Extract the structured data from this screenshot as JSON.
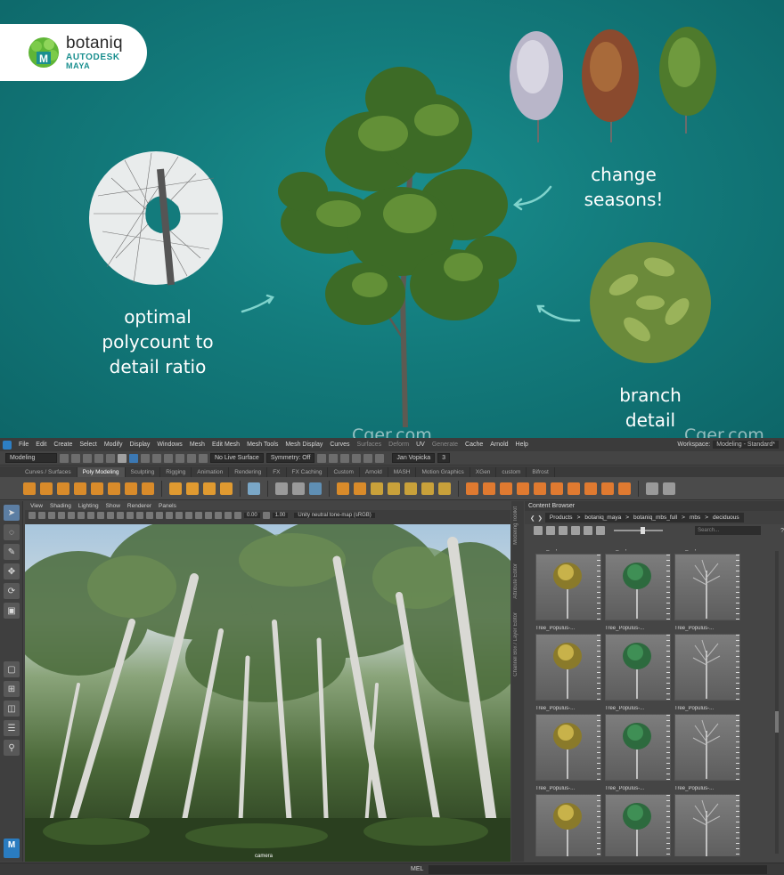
{
  "banner": {
    "logo": {
      "brand": "botaniq",
      "vendor": "AUTODESK",
      "product": "MAYA"
    },
    "captions": {
      "polycount": "optimal polycount to detail ratio",
      "seasons": "change seasons!",
      "branch": "branch detail"
    },
    "watermark_left": "Cger.com",
    "watermark_right": "Cger.com",
    "colors": {
      "background": "#137b7c",
      "accent": "#1a8f8f",
      "arrow": "#7fd3cc"
    }
  },
  "maya": {
    "menubar": {
      "items": [
        "File",
        "Edit",
        "Create",
        "Select",
        "Modify",
        "Display",
        "Windows",
        "Mesh",
        "Edit Mesh",
        "Mesh Tools",
        "Mesh Display",
        "Curves",
        "Surfaces",
        "Deform",
        "UV",
        "Generate",
        "Cache",
        "Arnold",
        "Help"
      ],
      "workspace_label": "Workspace:",
      "workspace_value": "Modeling - Standard*"
    },
    "statusline": {
      "mode": "Modeling",
      "live_surface": "No Live Surface",
      "symmetry": "Symmetry: Off",
      "user": "Jan Vopicka",
      "notifications": "3"
    },
    "shelf_tabs": [
      "Curves / Surfaces",
      "Poly Modeling",
      "Sculpting",
      "Rigging",
      "Animation",
      "Rendering",
      "FX",
      "FX Caching",
      "Custom",
      "Arnold",
      "MASH",
      "Motion Graphics",
      "XGen",
      "custom",
      "Bifrost"
    ],
    "active_shelf_tab": "Poly Modeling",
    "viewport": {
      "menus": [
        "View",
        "Shading",
        "Lighting",
        "Show",
        "Renderer",
        "Panels"
      ],
      "exposure": "0.00",
      "gamma": "1.00",
      "tonemap": "Unity neutral tone-map (sRGB)",
      "camera_label": "camera"
    },
    "side_tabs": [
      "Modeling Toolkit",
      "Attribute Editor",
      "Channel Box / Layer Editor"
    ],
    "content_browser": {
      "title": "Content Browser",
      "path": [
        "Products",
        "botaniq_maya",
        "botaniq_mbs_full",
        "mbs",
        "deciduous"
      ],
      "search_placeholder": "Search...",
      "tile_label": "Tree_Populus-..."
    },
    "cmdline": {
      "label": "MEL"
    },
    "toolbox_badge": "M"
  }
}
